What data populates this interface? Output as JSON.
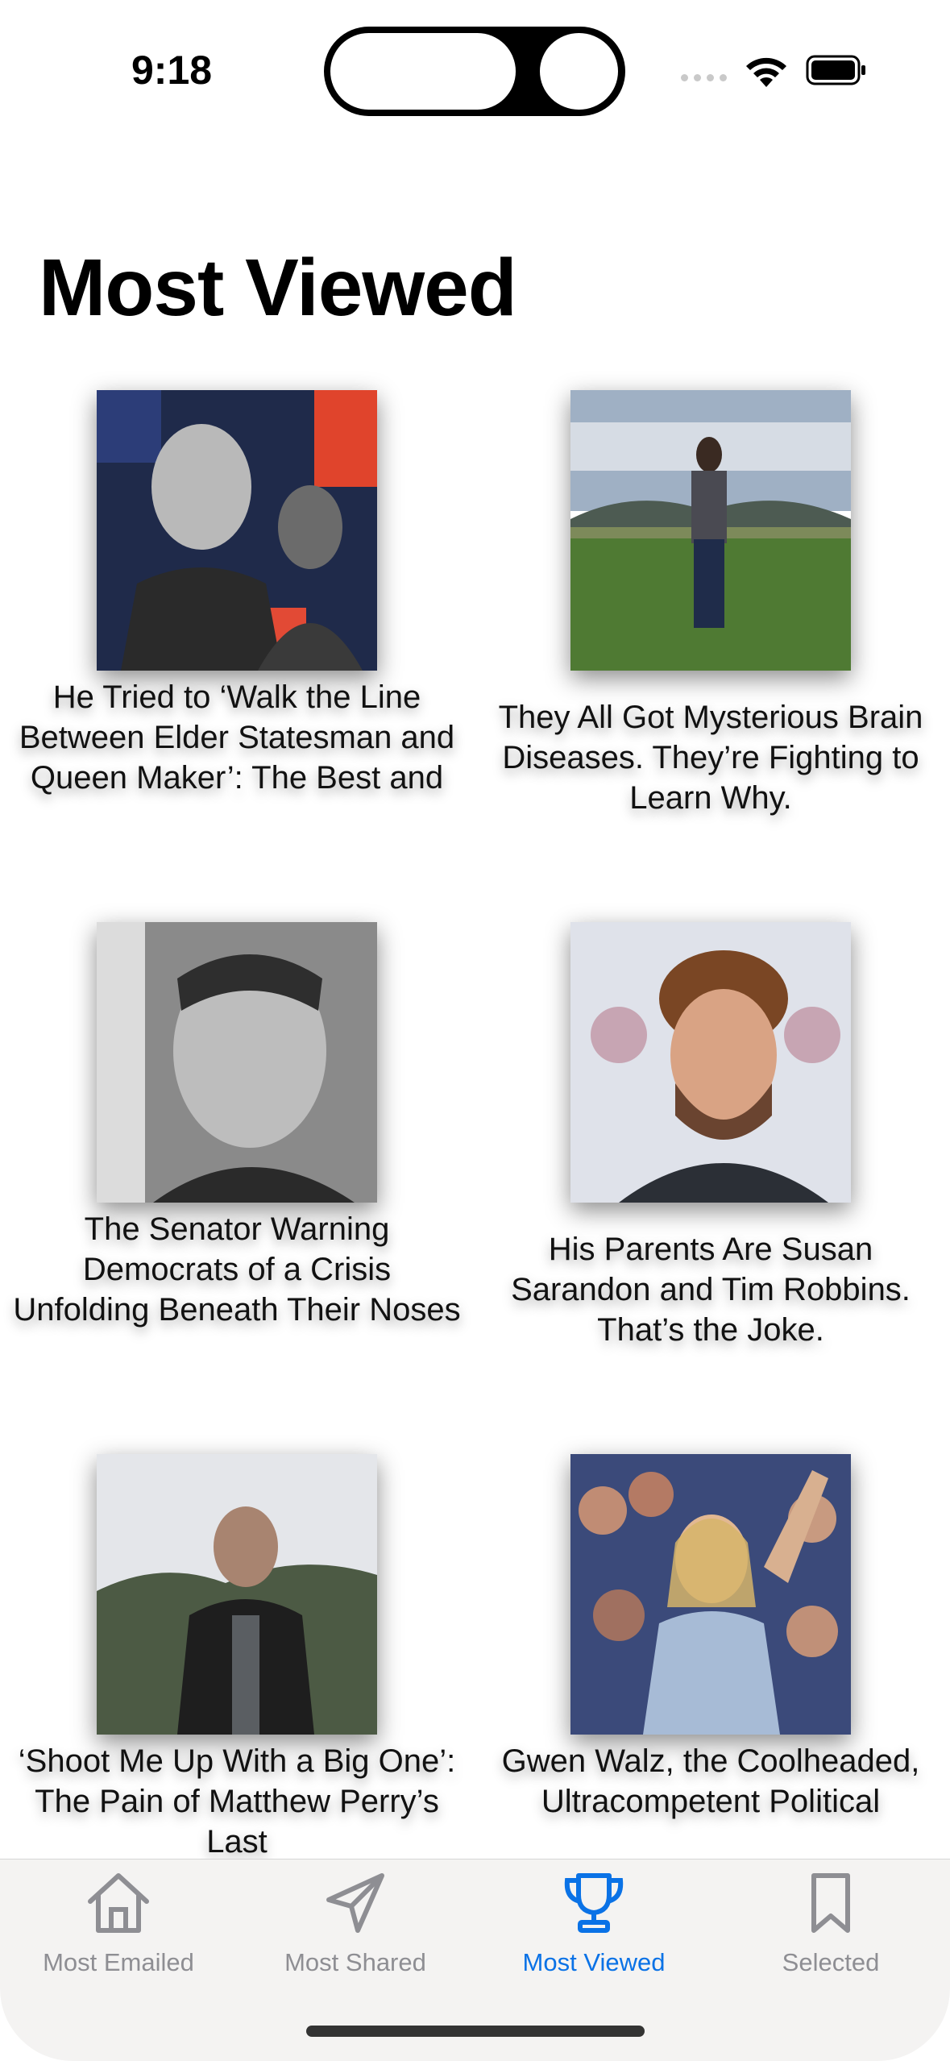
{
  "status": {
    "time": "9:18"
  },
  "page": {
    "title": "Most Viewed"
  },
  "articles": [
    {
      "title": "He Tried to ‘Walk the Line Between Elder Statesman and Queen Maker’: The Best and"
    },
    {
      "title": "They All Got Mysterious Brain Diseases. They’re Fighting to Learn Why."
    },
    {
      "title": "The Senator Warning Democrats of a Crisis Unfolding Beneath Their Noses"
    },
    {
      "title": "His Parents Are Susan Sarandon and Tim Robbins. That’s the Joke."
    },
    {
      "title": "‘Shoot Me Up With a Big One’: The Pain of Matthew Perry’s Last"
    },
    {
      "title": "Gwen Walz, the Coolheaded, Ultracompetent Political"
    }
  ],
  "tabs": [
    {
      "label": "Most Emailed",
      "icon": "house-icon",
      "active": false
    },
    {
      "label": "Most Shared",
      "icon": "paper-plane-icon",
      "active": false
    },
    {
      "label": "Most Viewed",
      "icon": "trophy-icon",
      "active": true
    },
    {
      "label": "Selected",
      "icon": "bookmark-icon",
      "active": false
    }
  ],
  "colors": {
    "accent": "#0a72e6",
    "inactive": "#8e8e93",
    "tabbar_bg": "#f4f3f2"
  }
}
